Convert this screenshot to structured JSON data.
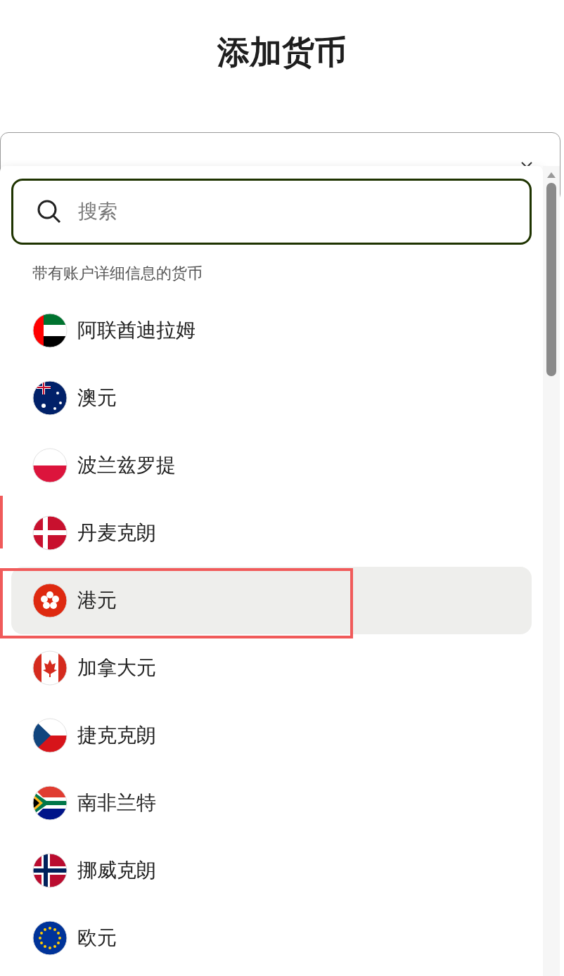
{
  "title": "添加货币",
  "dropdown": {
    "search": {
      "placeholder": "搜索"
    },
    "section_label": "带有账户详细信息的货币",
    "items": [
      {
        "kind": "ae",
        "label": "阿联酋迪拉姆",
        "selected": false
      },
      {
        "kind": "au",
        "label": "澳元",
        "selected": false
      },
      {
        "kind": "pl",
        "label": "波兰兹罗提",
        "selected": false
      },
      {
        "kind": "dk",
        "label": "丹麦克朗",
        "selected": false
      },
      {
        "kind": "hk",
        "label": "港元",
        "selected": true
      },
      {
        "kind": "ca",
        "label": "加拿大元",
        "selected": false
      },
      {
        "kind": "cz",
        "label": "捷克克朗",
        "selected": false
      },
      {
        "kind": "za",
        "label": "南非兰特",
        "selected": false
      },
      {
        "kind": "no",
        "label": "挪威克朗",
        "selected": false
      },
      {
        "kind": "eu",
        "label": "欧元",
        "selected": false
      }
    ]
  }
}
